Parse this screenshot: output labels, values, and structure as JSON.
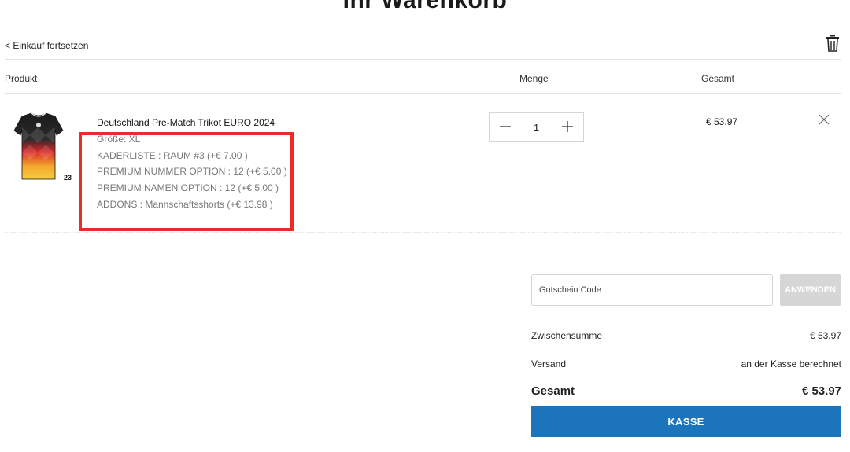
{
  "header": {
    "title": "Ihr Warenkorb",
    "continue_link": "< Einkauf fortsetzen"
  },
  "icons": {
    "trash": "trash-icon",
    "remove": "close-icon",
    "minus": "minus-icon",
    "plus": "plus-icon"
  },
  "table": {
    "headers": {
      "product": "Produkt",
      "quantity": "Menge",
      "total": "Gesamt"
    }
  },
  "cart_item": {
    "name": "Deutschland Pre-Match Trikot EURO 2024",
    "options": [
      "Größe: XL",
      "KADERLISTE : RAUM #3 (+€ 7.00 )",
      "PREMIUM NUMMER OPTION : 12 (+€ 5.00 )",
      "PREMIUM NAMEN OPTION : 12 (+€ 5.00 )",
      "ADDONS : Mannschaftsshorts (+€ 13.98 )"
    ],
    "quantity": "1",
    "line_total": "€ 53.97",
    "image_badge": "23"
  },
  "coupon": {
    "placeholder": "Gutschein Code",
    "apply_label": "ANWENDEN"
  },
  "summary": {
    "subtotal_label": "Zwischensumme",
    "subtotal_value": "€ 53.97",
    "shipping_label": "Versand",
    "shipping_value": "an der Kasse berechnet",
    "total_label": "Gesamt",
    "total_value": "€ 53.97"
  },
  "checkout": {
    "label": "KASSE"
  },
  "colors": {
    "checkout_button": "#1b74bc",
    "highlight_border": "#ee2b2b",
    "apply_button": "#d6d6d6"
  }
}
